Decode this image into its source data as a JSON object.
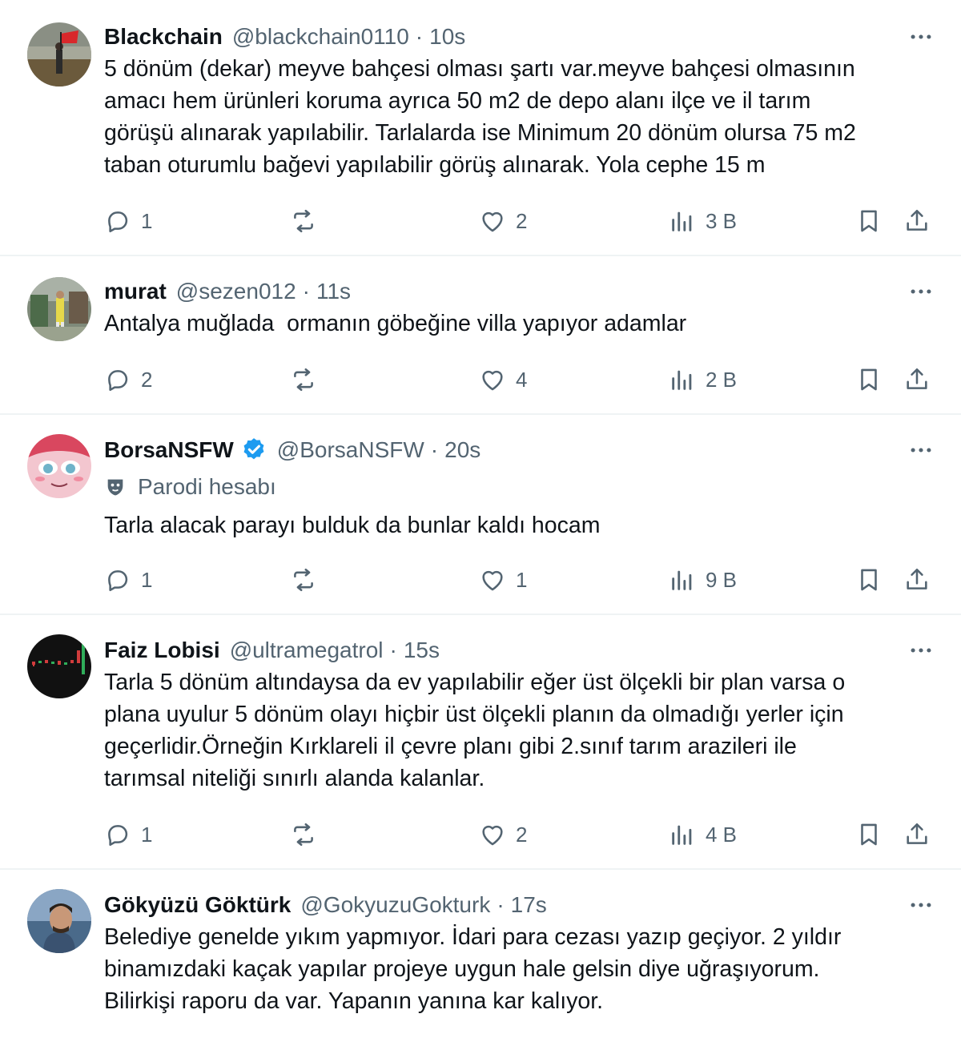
{
  "tweets": [
    {
      "name": "Blackchain",
      "handle": "@blackchain0110",
      "time": "10s",
      "verified": false,
      "text": "5 dönüm (dekar) meyve bahçesi olması şartı var.meyve bahçesi olmasının\namacı hem ürünleri koruma ayrıca 50 m2 de depo alanı ilçe ve il tarım\ngörüşü alınarak yapılabilir. Tarlalarda ise Minimum 20 dönüm olursa 75 m2\ntaban oturumlu bağevi yapılabilir görüş alınarak. Yola cephe 15 m",
      "replies": "1",
      "retweets": "",
      "likes": "2",
      "views": "3 B"
    },
    {
      "name": "murat",
      "handle": "@sezen012",
      "time": "11s",
      "verified": false,
      "text": "Antalya muğlada  ormanın göbeğine villa yapıyor adamlar",
      "replies": "2",
      "retweets": "",
      "likes": "4",
      "views": "2 B"
    },
    {
      "name": "BorsaNSFW",
      "handle": "@BorsaNSFW",
      "time": "20s",
      "verified": true,
      "parody_label": "Parodi hesabı",
      "text": "Tarla alacak parayı bulduk da bunlar kaldı hocam",
      "replies": "1",
      "retweets": "",
      "likes": "1",
      "views": "9 B"
    },
    {
      "name": "Faiz Lobisi",
      "handle": "@ultramegatrol",
      "time": "15s",
      "verified": false,
      "text": "Tarla 5 dönüm altındaysa da ev yapılabilir eğer üst ölçekli bir plan varsa o\nplana uyulur 5 dönüm olayı hiçbir üst ölçekli planın da olmadığı yerler için\ngeçerlidir.Örneğin Kırklareli il çevre planı gibi 2.sınıf tarım arazileri ile\ntarımsal niteliği sınırlı alanda kalanlar.",
      "replies": "1",
      "retweets": "",
      "likes": "2",
      "views": "4 B"
    },
    {
      "name": "Gökyüzü Göktürk",
      "handle": "@GokyuzuGokturk",
      "time": "17s",
      "verified": false,
      "text": "Belediye genelde yıkım yapmıyor. İdari para cezası yazıp geçiyor. 2 yıldır\nbinamızdaki kaçak yapılar projeye uygun hale gelsin diye uğraşıyorum.\nBilirkişi raporu da var. Yapanın yanına kar kalıyor."
    }
  ],
  "colors": {
    "text_primary": "#0f1419",
    "text_secondary": "#536471",
    "divider": "#eff3f4",
    "verified_blue": "#1d9bf0"
  },
  "icons": {
    "reply": "reply-icon",
    "retweet": "retweet-icon",
    "like": "heart-icon",
    "views": "views-chart-icon",
    "bookmark": "bookmark-icon",
    "share": "share-icon",
    "more": "more-dots-icon",
    "verified": "verified-badge-icon",
    "parody": "parody-mask-icon"
  }
}
